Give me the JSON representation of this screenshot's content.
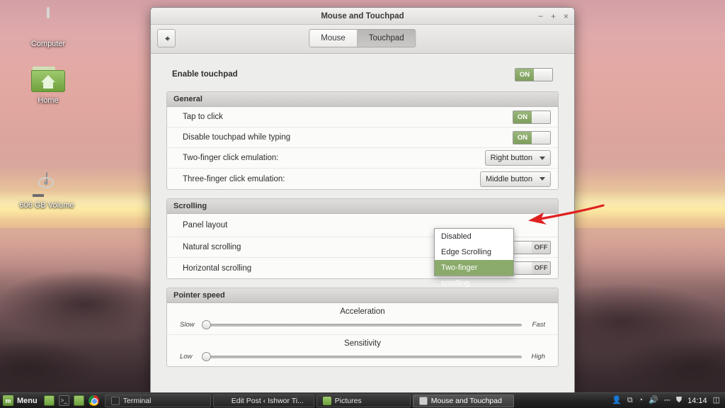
{
  "desktop": {
    "icons": [
      {
        "label": "Computer",
        "icon": "monitor-icon"
      },
      {
        "label": "Home",
        "icon": "home-folder-icon"
      },
      {
        "label": "606 GB Volume",
        "icon": "hard-drive-icon"
      }
    ]
  },
  "window": {
    "title": "Mouse and Touchpad",
    "controls": {
      "minimize": "−",
      "maximize": "+",
      "close": "×"
    },
    "back_button": "⬅",
    "tabs": [
      {
        "label": "Mouse",
        "active": false
      },
      {
        "label": "Touchpad",
        "active": true
      }
    ],
    "enable_touchpad": {
      "label": "Enable touchpad",
      "state": "ON"
    },
    "sections": [
      {
        "title": "General",
        "rows": [
          {
            "label": "Tap to click",
            "control": "toggle",
            "state": "ON"
          },
          {
            "label": "Disable touchpad while typing",
            "control": "toggle",
            "state": "ON"
          },
          {
            "label": "Two-finger click emulation:",
            "control": "combo",
            "value": "Right button"
          },
          {
            "label": "Three-finger click emulation:",
            "control": "combo",
            "value": "Middle button"
          }
        ]
      },
      {
        "title": "Scrolling",
        "rows": [
          {
            "label": "Panel layout",
            "control": "combo",
            "value": ""
          },
          {
            "label": "Natural scrolling",
            "control": "toggle",
            "state": "OFF"
          },
          {
            "label": "Horizontal scrolling",
            "control": "toggle",
            "state": "OFF"
          }
        ]
      },
      {
        "title": "Pointer speed",
        "sliders": [
          {
            "title": "Acceleration",
            "min_label": "Slow",
            "max_label": "Fast",
            "value_pct": 2
          },
          {
            "title": "Sensitivity",
            "min_label": "Low",
            "max_label": "High",
            "value_pct": 2
          }
        ]
      }
    ],
    "dropdown": {
      "open": true,
      "items": [
        {
          "label": "Disabled",
          "selected": false
        },
        {
          "label": "Edge Scrolling",
          "selected": false
        },
        {
          "label": "Two-finger scrolling",
          "selected": true
        }
      ]
    }
  },
  "annotation": {
    "arrow_color": "#e02020",
    "points_to": "Two-finger scrolling"
  },
  "taskbar": {
    "menu_label": "Menu",
    "menu_icon": "mint-logo-icon",
    "quick_launch": [
      {
        "name": "show-desktop-icon"
      },
      {
        "name": "terminal-icon"
      },
      {
        "name": "file-manager-icon"
      },
      {
        "name": "chrome-icon"
      }
    ],
    "tasks": [
      {
        "label": "Terminal",
        "icon": "terminal-icon",
        "active": false
      },
      {
        "label": "Edit Post ‹ Ishwor Ti...",
        "icon": "chrome-icon",
        "active": false
      },
      {
        "label": "Pictures",
        "icon": "folder-icon",
        "active": false
      },
      {
        "label": "Mouse and Touchpad",
        "icon": "mouse-settings-icon",
        "active": true
      }
    ],
    "tray": [
      {
        "name": "user-icon",
        "glyph": "👤"
      },
      {
        "name": "update-manager-icon",
        "glyph": "⧉"
      },
      {
        "name": "network-wifi-icon",
        "glyph": "◔"
      },
      {
        "name": "volume-icon",
        "glyph": "🔊"
      },
      {
        "name": "battery-icon",
        "glyph": "⎓"
      },
      {
        "name": "shield-icon",
        "glyph": "⛊"
      }
    ],
    "clock": "14:14",
    "workspace_icon": "workspace-switcher-icon"
  },
  "colors": {
    "toggle_on": "#8aab6b",
    "highlight": "#8aab6b",
    "arrow": "#e02020"
  }
}
